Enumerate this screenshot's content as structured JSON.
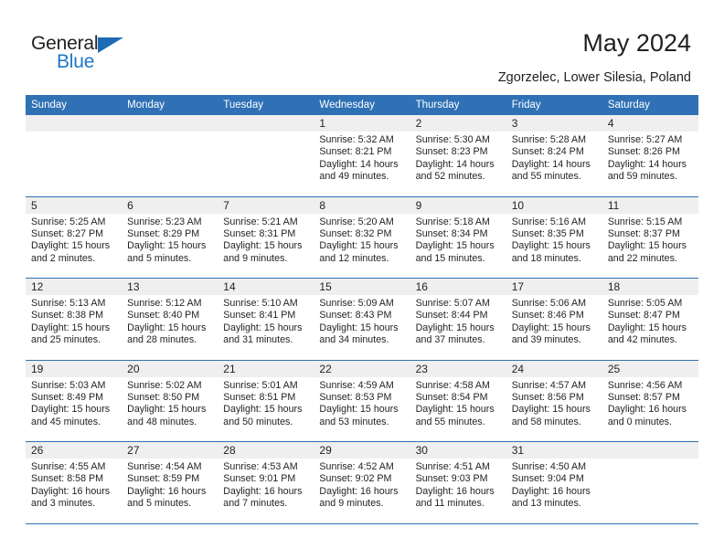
{
  "logo": {
    "word1": "General",
    "word2": "Blue",
    "triangle_color": "#1b6cb5",
    "blue_color": "#1b78c8",
    "icon": "triangle-flag-icon"
  },
  "header": {
    "title": "May 2024",
    "subtitle": "Zgorzelec, Lower Silesia, Poland"
  },
  "colors": {
    "header_blue": "#3071b5",
    "day_band_gray": "#efefef",
    "text": "#231f20"
  },
  "calendar": {
    "weekday_headers": [
      "Sunday",
      "Monday",
      "Tuesday",
      "Wednesday",
      "Thursday",
      "Friday",
      "Saturday"
    ],
    "weeks": [
      [
        {
          "day": "",
          "lines": []
        },
        {
          "day": "",
          "lines": []
        },
        {
          "day": "",
          "lines": []
        },
        {
          "day": "1",
          "lines": [
            "Sunrise: 5:32 AM",
            "Sunset: 8:21 PM",
            "Daylight: 14 hours",
            "and 49 minutes."
          ]
        },
        {
          "day": "2",
          "lines": [
            "Sunrise: 5:30 AM",
            "Sunset: 8:23 PM",
            "Daylight: 14 hours",
            "and 52 minutes."
          ]
        },
        {
          "day": "3",
          "lines": [
            "Sunrise: 5:28 AM",
            "Sunset: 8:24 PM",
            "Daylight: 14 hours",
            "and 55 minutes."
          ]
        },
        {
          "day": "4",
          "lines": [
            "Sunrise: 5:27 AM",
            "Sunset: 8:26 PM",
            "Daylight: 14 hours",
            "and 59 minutes."
          ]
        }
      ],
      [
        {
          "day": "5",
          "lines": [
            "Sunrise: 5:25 AM",
            "Sunset: 8:27 PM",
            "Daylight: 15 hours",
            "and 2 minutes."
          ]
        },
        {
          "day": "6",
          "lines": [
            "Sunrise: 5:23 AM",
            "Sunset: 8:29 PM",
            "Daylight: 15 hours",
            "and 5 minutes."
          ]
        },
        {
          "day": "7",
          "lines": [
            "Sunrise: 5:21 AM",
            "Sunset: 8:31 PM",
            "Daylight: 15 hours",
            "and 9 minutes."
          ]
        },
        {
          "day": "8",
          "lines": [
            "Sunrise: 5:20 AM",
            "Sunset: 8:32 PM",
            "Daylight: 15 hours",
            "and 12 minutes."
          ]
        },
        {
          "day": "9",
          "lines": [
            "Sunrise: 5:18 AM",
            "Sunset: 8:34 PM",
            "Daylight: 15 hours",
            "and 15 minutes."
          ]
        },
        {
          "day": "10",
          "lines": [
            "Sunrise: 5:16 AM",
            "Sunset: 8:35 PM",
            "Daylight: 15 hours",
            "and 18 minutes."
          ]
        },
        {
          "day": "11",
          "lines": [
            "Sunrise: 5:15 AM",
            "Sunset: 8:37 PM",
            "Daylight: 15 hours",
            "and 22 minutes."
          ]
        }
      ],
      [
        {
          "day": "12",
          "lines": [
            "Sunrise: 5:13 AM",
            "Sunset: 8:38 PM",
            "Daylight: 15 hours",
            "and 25 minutes."
          ]
        },
        {
          "day": "13",
          "lines": [
            "Sunrise: 5:12 AM",
            "Sunset: 8:40 PM",
            "Daylight: 15 hours",
            "and 28 minutes."
          ]
        },
        {
          "day": "14",
          "lines": [
            "Sunrise: 5:10 AM",
            "Sunset: 8:41 PM",
            "Daylight: 15 hours",
            "and 31 minutes."
          ]
        },
        {
          "day": "15",
          "lines": [
            "Sunrise: 5:09 AM",
            "Sunset: 8:43 PM",
            "Daylight: 15 hours",
            "and 34 minutes."
          ]
        },
        {
          "day": "16",
          "lines": [
            "Sunrise: 5:07 AM",
            "Sunset: 8:44 PM",
            "Daylight: 15 hours",
            "and 37 minutes."
          ]
        },
        {
          "day": "17",
          "lines": [
            "Sunrise: 5:06 AM",
            "Sunset: 8:46 PM",
            "Daylight: 15 hours",
            "and 39 minutes."
          ]
        },
        {
          "day": "18",
          "lines": [
            "Sunrise: 5:05 AM",
            "Sunset: 8:47 PM",
            "Daylight: 15 hours",
            "and 42 minutes."
          ]
        }
      ],
      [
        {
          "day": "19",
          "lines": [
            "Sunrise: 5:03 AM",
            "Sunset: 8:49 PM",
            "Daylight: 15 hours",
            "and 45 minutes."
          ]
        },
        {
          "day": "20",
          "lines": [
            "Sunrise: 5:02 AM",
            "Sunset: 8:50 PM",
            "Daylight: 15 hours",
            "and 48 minutes."
          ]
        },
        {
          "day": "21",
          "lines": [
            "Sunrise: 5:01 AM",
            "Sunset: 8:51 PM",
            "Daylight: 15 hours",
            "and 50 minutes."
          ]
        },
        {
          "day": "22",
          "lines": [
            "Sunrise: 4:59 AM",
            "Sunset: 8:53 PM",
            "Daylight: 15 hours",
            "and 53 minutes."
          ]
        },
        {
          "day": "23",
          "lines": [
            "Sunrise: 4:58 AM",
            "Sunset: 8:54 PM",
            "Daylight: 15 hours",
            "and 55 minutes."
          ]
        },
        {
          "day": "24",
          "lines": [
            "Sunrise: 4:57 AM",
            "Sunset: 8:56 PM",
            "Daylight: 15 hours",
            "and 58 minutes."
          ]
        },
        {
          "day": "25",
          "lines": [
            "Sunrise: 4:56 AM",
            "Sunset: 8:57 PM",
            "Daylight: 16 hours",
            "and 0 minutes."
          ]
        }
      ],
      [
        {
          "day": "26",
          "lines": [
            "Sunrise: 4:55 AM",
            "Sunset: 8:58 PM",
            "Daylight: 16 hours",
            "and 3 minutes."
          ]
        },
        {
          "day": "27",
          "lines": [
            "Sunrise: 4:54 AM",
            "Sunset: 8:59 PM",
            "Daylight: 16 hours",
            "and 5 minutes."
          ]
        },
        {
          "day": "28",
          "lines": [
            "Sunrise: 4:53 AM",
            "Sunset: 9:01 PM",
            "Daylight: 16 hours",
            "and 7 minutes."
          ]
        },
        {
          "day": "29",
          "lines": [
            "Sunrise: 4:52 AM",
            "Sunset: 9:02 PM",
            "Daylight: 16 hours",
            "and 9 minutes."
          ]
        },
        {
          "day": "30",
          "lines": [
            "Sunrise: 4:51 AM",
            "Sunset: 9:03 PM",
            "Daylight: 16 hours",
            "and 11 minutes."
          ]
        },
        {
          "day": "31",
          "lines": [
            "Sunrise: 4:50 AM",
            "Sunset: 9:04 PM",
            "Daylight: 16 hours",
            "and 13 minutes."
          ]
        },
        {
          "day": "",
          "lines": []
        }
      ]
    ]
  }
}
